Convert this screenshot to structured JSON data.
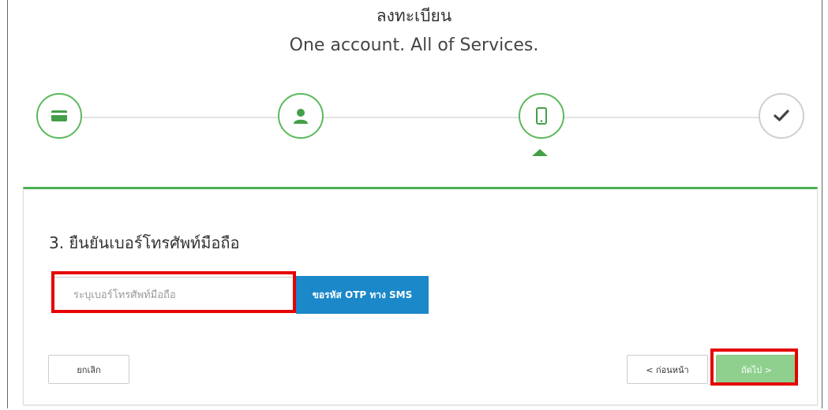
{
  "header": {
    "title": "ลงทะเบียน",
    "subtitle": "One account. All of Services."
  },
  "steps": [
    {
      "icon": "credit-card-icon",
      "state": "complete"
    },
    {
      "icon": "user-icon",
      "state": "complete"
    },
    {
      "icon": "mobile-phone-icon",
      "state": "active"
    },
    {
      "icon": "checkmark-icon",
      "state": "pending"
    }
  ],
  "form": {
    "heading": "3. ยืนยันเบอร์โทรศัพท์มือถือ",
    "phone_placeholder": "ระบุเบอร์โทรศัพท์มือถือ",
    "phone_value": "",
    "otp_button_label": "ขอรหัส OTP ทาง SMS"
  },
  "actions": {
    "cancel_label": "ยกเลิก",
    "prev_label": "< ก่อนหน้า",
    "next_label": "ถัดไป >"
  },
  "colors": {
    "accent_green": "#4caf50",
    "otp_blue": "#1a88c9",
    "next_disabled_green": "#8fd08f",
    "highlight_red": "#e60000"
  }
}
